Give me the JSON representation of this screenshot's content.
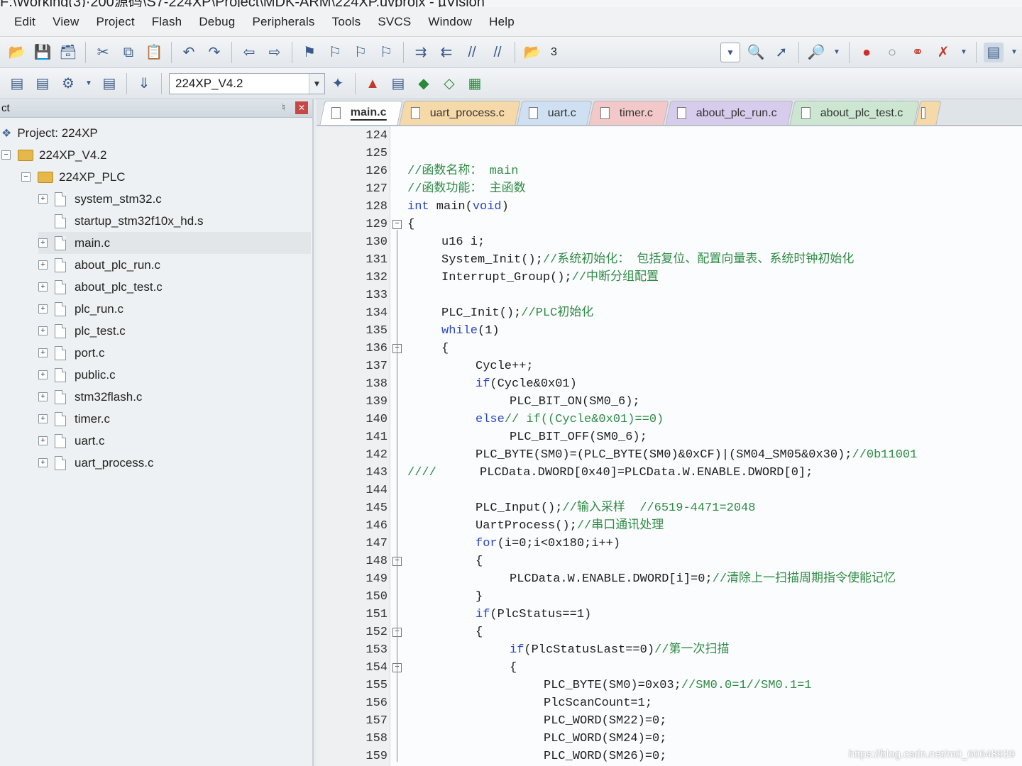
{
  "window": {
    "title": "F:\\Working(3)·200源码\\S7-224XP\\Project\\MDK-ARM\\224XP.uvprojx - µVision"
  },
  "menu": [
    "Edit",
    "View",
    "Project",
    "Flash",
    "Debug",
    "Peripherals",
    "Tools",
    "SVCS",
    "Window",
    "Help"
  ],
  "toolbar1": {
    "icons": [
      "open-icon",
      "save-icon",
      "save-all-icon",
      "cut-icon",
      "copy-icon",
      "paste-icon",
      "undo-icon",
      "redo-icon",
      "nav-back-icon",
      "nav-forward-icon",
      "bookmark-icon",
      "bookmark-prev-icon",
      "bookmark-next-icon",
      "bookmark-clear-icon",
      "indent-icon",
      "unindent-icon",
      "comment-icon",
      "uncomment-icon",
      "find-in-files-icon"
    ],
    "find_value": "3",
    "right_icons": [
      "debug-session-icon",
      "breakpoint-insert-icon",
      "breakpoint-enable-icon",
      "breakpoint-disable-icon",
      "breakpoint-kill-icon",
      "window-layout-icon"
    ]
  },
  "toolbar2": {
    "target_name": "224XP_V4.2",
    "icons": [
      "translate-icon",
      "build-icon",
      "rebuild-icon",
      "batch-build-icon",
      "download-icon"
    ]
  },
  "project_panel": {
    "title": "ct",
    "tree": [
      {
        "label": "Project: 224XP",
        "depth": 0,
        "kind": "project",
        "expander": ""
      },
      {
        "label": "224XP_V4.2",
        "depth": 1,
        "kind": "folder",
        "expander": "−"
      },
      {
        "label": "224XP_PLC",
        "depth": 2,
        "kind": "folder",
        "expander": "−"
      },
      {
        "label": "system_stm32.c",
        "depth": 3,
        "kind": "file",
        "expander": "+"
      },
      {
        "label": "startup_stm32f10x_hd.s",
        "depth": 3,
        "kind": "file",
        "expander": ""
      },
      {
        "label": "main.c",
        "depth": 3,
        "kind": "file",
        "expander": "+"
      },
      {
        "label": "about_plc_run.c",
        "depth": 3,
        "kind": "file",
        "expander": "+"
      },
      {
        "label": "about_plc_test.c",
        "depth": 3,
        "kind": "file",
        "expander": "+"
      },
      {
        "label": "plc_run.c",
        "depth": 3,
        "kind": "file",
        "expander": "+"
      },
      {
        "label": "plc_test.c",
        "depth": 3,
        "kind": "file",
        "expander": "+"
      },
      {
        "label": "port.c",
        "depth": 3,
        "kind": "file",
        "expander": "+"
      },
      {
        "label": "public.c",
        "depth": 3,
        "kind": "file",
        "expander": "+"
      },
      {
        "label": "stm32flash.c",
        "depth": 3,
        "kind": "file",
        "expander": "+"
      },
      {
        "label": "timer.c",
        "depth": 3,
        "kind": "file",
        "expander": "+"
      },
      {
        "label": "uart.c",
        "depth": 3,
        "kind": "file",
        "expander": "+"
      },
      {
        "label": "uart_process.c",
        "depth": 3,
        "kind": "file",
        "expander": "+"
      }
    ]
  },
  "tabs": [
    {
      "label": "main.c",
      "active": true,
      "color": "active"
    },
    {
      "label": "uart_process.c",
      "active": false,
      "color": "c1"
    },
    {
      "label": "uart.c",
      "active": false,
      "color": "c2"
    },
    {
      "label": "timer.c",
      "active": false,
      "color": "c3"
    },
    {
      "label": "about_plc_run.c",
      "active": false,
      "color": "c4"
    },
    {
      "label": "about_plc_test.c",
      "active": false,
      "color": "c5"
    },
    {
      "label": "",
      "active": false,
      "color": "c6"
    }
  ],
  "code_lines": [
    {
      "n": "124",
      "indent": 0,
      "segs": []
    },
    {
      "n": "125",
      "indent": 0,
      "segs": []
    },
    {
      "n": "126",
      "indent": 0,
      "segs": [
        [
          "cm",
          "//函数名称： main"
        ]
      ]
    },
    {
      "n": "127",
      "indent": 0,
      "segs": [
        [
          "cm",
          "//函数功能： 主函数"
        ]
      ]
    },
    {
      "n": "128",
      "indent": 0,
      "segs": [
        [
          "kw",
          "int"
        ],
        [
          "tx",
          " main("
        ],
        [
          "kw",
          "void"
        ],
        [
          "tx",
          ")"
        ]
      ]
    },
    {
      "n": "129",
      "indent": 0,
      "fold": "−",
      "segs": [
        [
          "tx",
          "{"
        ]
      ]
    },
    {
      "n": "130",
      "indent": 1,
      "segs": [
        [
          "tx",
          "u16 i;"
        ]
      ]
    },
    {
      "n": "131",
      "indent": 1,
      "segs": [
        [
          "tx",
          "System_Init();"
        ],
        [
          "cm",
          "//系统初始化： 包括复位、配置向量表、系统时钟初始化"
        ]
      ]
    },
    {
      "n": "132",
      "indent": 1,
      "segs": [
        [
          "tx",
          "Interrupt_Group();"
        ],
        [
          "cm",
          "//中断分组配置"
        ]
      ]
    },
    {
      "n": "133",
      "indent": 0,
      "segs": []
    },
    {
      "n": "134",
      "indent": 1,
      "segs": [
        [
          "tx",
          "PLC_Init();"
        ],
        [
          "cm",
          "//PLC初始化"
        ]
      ]
    },
    {
      "n": "135",
      "indent": 1,
      "segs": [
        [
          "kw",
          "while"
        ],
        [
          "tx",
          "(1)"
        ]
      ]
    },
    {
      "n": "136",
      "indent": 1,
      "fold": "−",
      "segs": [
        [
          "tx",
          "{"
        ]
      ]
    },
    {
      "n": "137",
      "indent": 2,
      "segs": [
        [
          "tx",
          "Cycle++;"
        ]
      ]
    },
    {
      "n": "138",
      "indent": 2,
      "segs": [
        [
          "kw",
          "if"
        ],
        [
          "tx",
          "(Cycle&0x01)"
        ]
      ]
    },
    {
      "n": "139",
      "indent": 3,
      "segs": [
        [
          "tx",
          "PLC_BIT_ON(SM0_6);"
        ]
      ]
    },
    {
      "n": "140",
      "indent": 2,
      "segs": [
        [
          "kw",
          "else"
        ],
        [
          "cm",
          "// if((Cycle&0x01)==0)"
        ]
      ]
    },
    {
      "n": "141",
      "indent": 3,
      "segs": [
        [
          "tx",
          "PLC_BIT_OFF(SM0_6);"
        ]
      ]
    },
    {
      "n": "142",
      "indent": 2,
      "segs": [
        [
          "tx",
          "PLC_BYTE(SM0)=(PLC_BYTE(SM0)&0xCF)|(SM04_SM05&0x30);"
        ],
        [
          "cm",
          "//0b11001"
        ]
      ]
    },
    {
      "n": "143",
      "indent": 0,
      "segs": [
        [
          "cm",
          "////"
        ],
        [
          "tx",
          "      PLCData.DWORD[0x40]=PLCData.W.ENABLE.DWORD[0];"
        ]
      ]
    },
    {
      "n": "144",
      "indent": 0,
      "segs": []
    },
    {
      "n": "145",
      "indent": 2,
      "segs": [
        [
          "tx",
          "PLC_Input();"
        ],
        [
          "cm",
          "//输入采样  //6519-4471=2048"
        ]
      ]
    },
    {
      "n": "146",
      "indent": 2,
      "segs": [
        [
          "tx",
          "UartProcess();"
        ],
        [
          "cm",
          "//串口通讯处理"
        ]
      ]
    },
    {
      "n": "147",
      "indent": 2,
      "segs": [
        [
          "kw",
          "for"
        ],
        [
          "tx",
          "(i=0;i<0x180;i++)"
        ]
      ]
    },
    {
      "n": "148",
      "indent": 2,
      "fold": "−",
      "segs": [
        [
          "tx",
          "{"
        ]
      ]
    },
    {
      "n": "149",
      "indent": 3,
      "segs": [
        [
          "tx",
          "PLCData.W.ENABLE.DWORD[i]=0;"
        ],
        [
          "cm",
          "//清除上一扫描周期指令使能记忆"
        ]
      ]
    },
    {
      "n": "150",
      "indent": 2,
      "segs": [
        [
          "tx",
          "}"
        ]
      ]
    },
    {
      "n": "151",
      "indent": 2,
      "segs": [
        [
          "kw",
          "if"
        ],
        [
          "tx",
          "(PlcStatus==1)"
        ]
      ]
    },
    {
      "n": "152",
      "indent": 2,
      "fold": "−",
      "segs": [
        [
          "tx",
          "{"
        ]
      ]
    },
    {
      "n": "153",
      "indent": 3,
      "segs": [
        [
          "kw",
          "if"
        ],
        [
          "tx",
          "(PlcStatusLast==0)"
        ],
        [
          "cm",
          "//第一次扫描"
        ]
      ]
    },
    {
      "n": "154",
      "indent": 3,
      "fold": "−",
      "segs": [
        [
          "tx",
          "{"
        ]
      ]
    },
    {
      "n": "155",
      "indent": 4,
      "segs": [
        [
          "tx",
          "PLC_BYTE(SM0)=0x03;"
        ],
        [
          "cm",
          "//SM0.0=1//SM0.1=1"
        ]
      ]
    },
    {
      "n": "156",
      "indent": 4,
      "segs": [
        [
          "tx",
          "PlcScanCount=1;"
        ]
      ]
    },
    {
      "n": "157",
      "indent": 4,
      "segs": [
        [
          "tx",
          "PLC_WORD(SM22)=0;"
        ]
      ]
    },
    {
      "n": "158",
      "indent": 4,
      "segs": [
        [
          "tx",
          "PLC_WORD(SM24)=0;"
        ]
      ]
    },
    {
      "n": "159",
      "indent": 4,
      "segs": [
        [
          "tx",
          "PLC_WORD(SM26)=0;"
        ]
      ]
    }
  ],
  "watermark": "https://blog.csdn.net/m0_60648939",
  "colors": {
    "keyword": "#2a47c8",
    "comment": "#2e8b45",
    "text": "#1e1e1e"
  }
}
